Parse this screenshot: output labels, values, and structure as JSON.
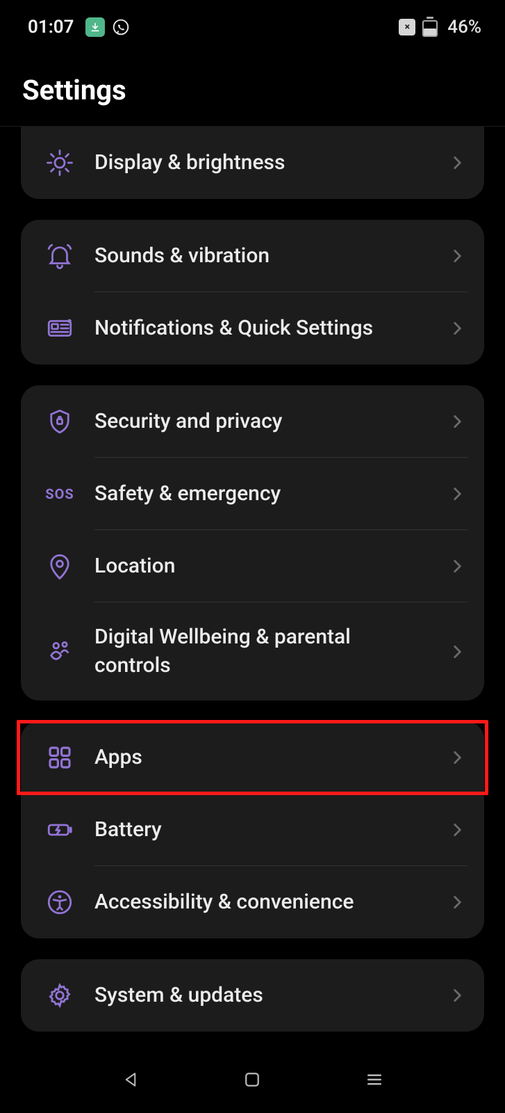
{
  "status": {
    "time": "01:07",
    "battery_pct": "46%"
  },
  "header": {
    "title": "Settings"
  },
  "groups": [
    {
      "rows": [
        {
          "id": "display",
          "icon": "brightness-icon",
          "label": "Display & brightness"
        }
      ]
    },
    {
      "rows": [
        {
          "id": "sounds",
          "icon": "bell-icon",
          "label": "Sounds & vibration"
        },
        {
          "id": "notifications",
          "icon": "notification-panel-icon",
          "label": "Notifications & Quick Settings"
        }
      ]
    },
    {
      "rows": [
        {
          "id": "security",
          "icon": "shield-icon",
          "label": "Security and privacy"
        },
        {
          "id": "safety",
          "icon": "sos-icon",
          "label": "Safety & emergency"
        },
        {
          "id": "location",
          "icon": "location-pin-icon",
          "label": "Location"
        },
        {
          "id": "wellbeing",
          "icon": "wellbeing-icon",
          "label": "Digital Wellbeing & parental controls"
        }
      ]
    },
    {
      "rows": [
        {
          "id": "apps",
          "icon": "apps-grid-icon",
          "label": "Apps"
        },
        {
          "id": "battery",
          "icon": "battery-icon",
          "label": "Battery"
        },
        {
          "id": "accessibility",
          "icon": "accessibility-icon",
          "label": "Accessibility & convenience"
        }
      ]
    },
    {
      "rows": [
        {
          "id": "system",
          "icon": "gear-icon",
          "label": "System & updates"
        }
      ]
    }
  ],
  "highlight": {
    "row_id": "apps"
  },
  "sos_text": "SOS"
}
